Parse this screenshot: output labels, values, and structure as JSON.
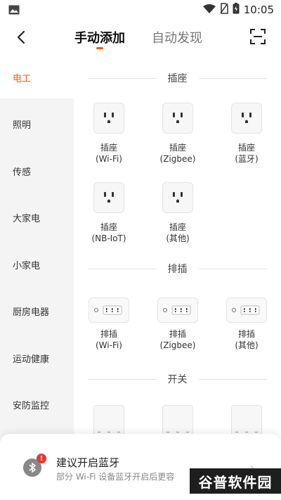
{
  "status_bar": {
    "time": "10:05"
  },
  "header": {
    "tabs": [
      {
        "label": "手动添加",
        "active": true
      },
      {
        "label": "自动发现",
        "active": false
      }
    ]
  },
  "sidebar": {
    "items": [
      {
        "label": "电工",
        "active": true
      },
      {
        "label": "照明"
      },
      {
        "label": "传感"
      },
      {
        "label": "大家电"
      },
      {
        "label": "小家电"
      },
      {
        "label": "厨房电器"
      },
      {
        "label": "运动健康"
      },
      {
        "label": "安防监控"
      }
    ]
  },
  "sections": {
    "socket": {
      "title": "插座",
      "devices": [
        {
          "name": "插座",
          "sub": "(Wi-Fi)"
        },
        {
          "name": "插座",
          "sub": "(Zigbee)"
        },
        {
          "name": "插座",
          "sub": "(蓝牙)"
        },
        {
          "name": "插座",
          "sub": "(NB-IoT)"
        },
        {
          "name": "插座",
          "sub": "(其他)"
        }
      ]
    },
    "strip": {
      "title": "排插",
      "devices": [
        {
          "name": "排插",
          "sub": "(Wi-Fi)"
        },
        {
          "name": "排插",
          "sub": "(Zigbee)"
        },
        {
          "name": "排插",
          "sub": "(其他)"
        }
      ]
    },
    "switch": {
      "title": "开关"
    }
  },
  "bluetooth_card": {
    "title": "建议开启蓝牙",
    "description": "部分 Wi-Fi 设备蓝牙开启后更容",
    "badge": "!"
  },
  "watermark": {
    "text": "谷普软件园"
  },
  "colors": {
    "accent": "#f05a1a",
    "sidebar_bg": "#f4f4f4",
    "badge": "#e53935"
  }
}
